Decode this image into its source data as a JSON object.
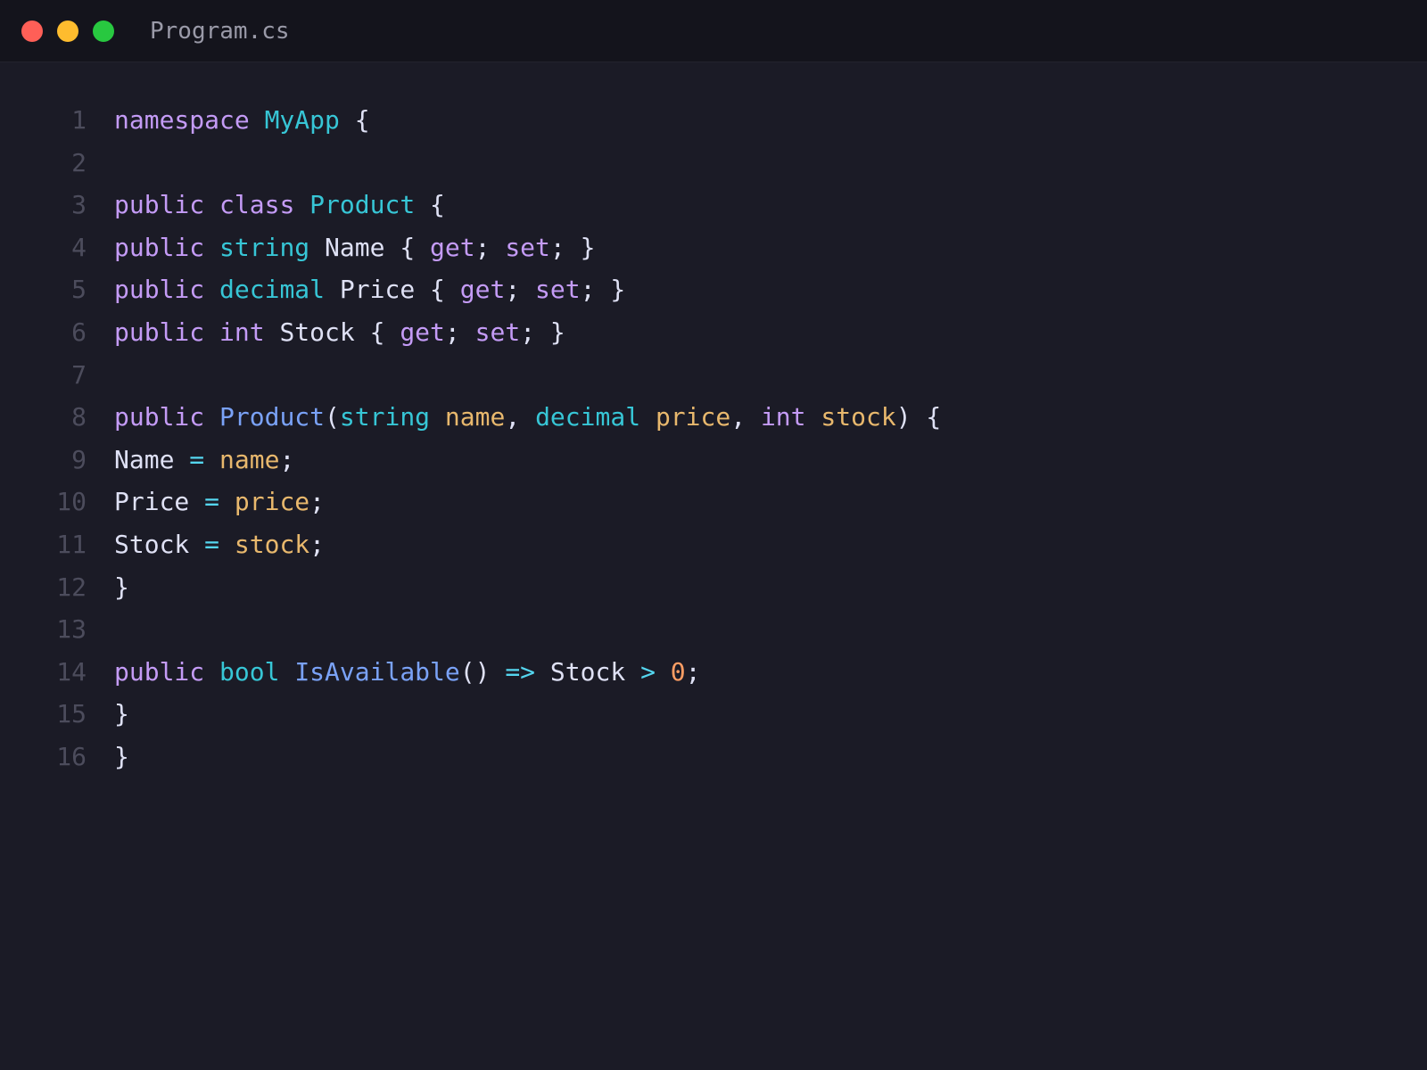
{
  "window": {
    "title": "Program.cs",
    "traffic_lights": [
      {
        "name": "close",
        "color": "#ff5f57"
      },
      {
        "name": "minimize",
        "color": "#febc2e"
      },
      {
        "name": "zoom",
        "color": "#28c840"
      }
    ]
  },
  "colors": {
    "keyword": "#c49bf6",
    "type": "#37c6d6",
    "function": "#7aa2f7",
    "parameter": "#e8b86d",
    "number": "#ff9e64",
    "operator": "#55d6ef",
    "plain": "#dfe1f5",
    "line_number": "#4c4c5c",
    "background": "#1b1b26",
    "titlebar": "#14141c"
  },
  "editor": {
    "lines": [
      {
        "number": "1",
        "tokens": [
          [
            "namespace",
            "keyword"
          ],
          [
            " ",
            "plain"
          ],
          [
            "MyApp",
            "type"
          ],
          [
            " {",
            "plain"
          ]
        ]
      },
      {
        "number": "2",
        "tokens": []
      },
      {
        "number": "3",
        "tokens": [
          [
            "public",
            "keyword"
          ],
          [
            " ",
            "plain"
          ],
          [
            "class",
            "keyword"
          ],
          [
            " ",
            "plain"
          ],
          [
            "Product",
            "type"
          ],
          [
            " {",
            "plain"
          ]
        ]
      },
      {
        "number": "4",
        "tokens": [
          [
            "public",
            "keyword"
          ],
          [
            " ",
            "plain"
          ],
          [
            "string",
            "type"
          ],
          [
            " Name { ",
            "plain"
          ],
          [
            "get",
            "keyword"
          ],
          [
            "; ",
            "plain"
          ],
          [
            "set",
            "keyword"
          ],
          [
            "; }",
            "plain"
          ]
        ]
      },
      {
        "number": "5",
        "tokens": [
          [
            "public",
            "keyword"
          ],
          [
            " ",
            "plain"
          ],
          [
            "decimal",
            "type"
          ],
          [
            " Price { ",
            "plain"
          ],
          [
            "get",
            "keyword"
          ],
          [
            "; ",
            "plain"
          ],
          [
            "set",
            "keyword"
          ],
          [
            "; }",
            "plain"
          ]
        ]
      },
      {
        "number": "6",
        "tokens": [
          [
            "public",
            "keyword"
          ],
          [
            " ",
            "plain"
          ],
          [
            "int",
            "keyword"
          ],
          [
            " Stock { ",
            "plain"
          ],
          [
            "get",
            "keyword"
          ],
          [
            "; ",
            "plain"
          ],
          [
            "set",
            "keyword"
          ],
          [
            "; }",
            "plain"
          ]
        ]
      },
      {
        "number": "7",
        "tokens": []
      },
      {
        "number": "8",
        "tokens": [
          [
            "public",
            "keyword"
          ],
          [
            " ",
            "plain"
          ],
          [
            "Product",
            "function"
          ],
          [
            "(",
            "plain"
          ],
          [
            "string",
            "type"
          ],
          [
            " ",
            "plain"
          ],
          [
            "name",
            "parameter"
          ],
          [
            ", ",
            "plain"
          ],
          [
            "decimal",
            "type"
          ],
          [
            " ",
            "plain"
          ],
          [
            "price",
            "parameter"
          ],
          [
            ", ",
            "plain"
          ],
          [
            "int",
            "keyword"
          ],
          [
            " ",
            "plain"
          ],
          [
            "stock",
            "parameter"
          ],
          [
            ") {",
            "plain"
          ]
        ]
      },
      {
        "number": "9",
        "tokens": [
          [
            "Name ",
            "plain"
          ],
          [
            "=",
            "operator"
          ],
          [
            " ",
            "plain"
          ],
          [
            "name",
            "parameter"
          ],
          [
            ";",
            "plain"
          ]
        ]
      },
      {
        "number": "10",
        "tokens": [
          [
            "Price ",
            "plain"
          ],
          [
            "=",
            "operator"
          ],
          [
            " ",
            "plain"
          ],
          [
            "price",
            "parameter"
          ],
          [
            ";",
            "plain"
          ]
        ]
      },
      {
        "number": "11",
        "tokens": [
          [
            "Stock ",
            "plain"
          ],
          [
            "=",
            "operator"
          ],
          [
            " ",
            "plain"
          ],
          [
            "stock",
            "parameter"
          ],
          [
            ";",
            "plain"
          ]
        ]
      },
      {
        "number": "12",
        "tokens": [
          [
            "}",
            "plain"
          ]
        ]
      },
      {
        "number": "13",
        "tokens": []
      },
      {
        "number": "14",
        "tokens": [
          [
            "public",
            "keyword"
          ],
          [
            " ",
            "plain"
          ],
          [
            "bool",
            "type"
          ],
          [
            " ",
            "plain"
          ],
          [
            "IsAvailable",
            "function"
          ],
          [
            "() ",
            "plain"
          ],
          [
            "=>",
            "operator"
          ],
          [
            " Stock ",
            "plain"
          ],
          [
            ">",
            "operator"
          ],
          [
            " ",
            "plain"
          ],
          [
            "0",
            "number"
          ],
          [
            ";",
            "plain"
          ]
        ]
      },
      {
        "number": "15",
        "tokens": [
          [
            "}",
            "plain"
          ]
        ]
      },
      {
        "number": "16",
        "tokens": [
          [
            "}",
            "plain"
          ]
        ]
      }
    ]
  }
}
